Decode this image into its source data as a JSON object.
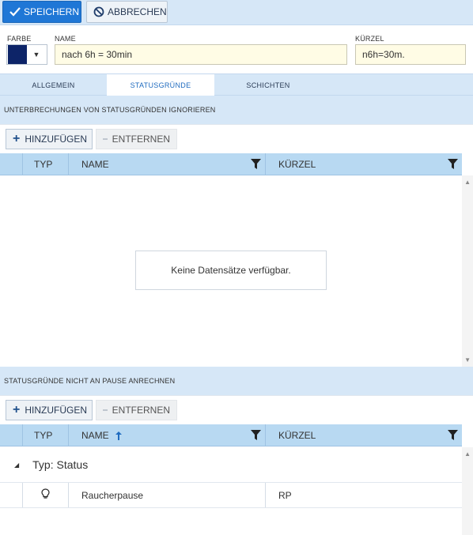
{
  "toolbar": {
    "save_label": "SPEICHERN",
    "cancel_label": "ABBRECHEN"
  },
  "fields": {
    "color_label": "FARBE",
    "color_value": "#0d2468",
    "name_label": "NAME",
    "name_value": "nach 6h = 30min",
    "short_label": "KÜRZEL",
    "short_value": "n6h=30m."
  },
  "tabs": [
    {
      "label": "ALLGEMEIN",
      "active": false
    },
    {
      "label": "STATUSGRÜNDE",
      "active": true
    },
    {
      "label": "SCHICHTEN",
      "active": false
    }
  ],
  "section1": {
    "title": "UNTERBRECHUNGEN VON STATUSGRÜNDEN IGNORIEREN",
    "add_label": "HINZUFÜGEN",
    "remove_label": "ENTFERNEN",
    "columns": {
      "type": "TYP",
      "name": "NAME",
      "short": "KÜRZEL"
    },
    "empty_text": "Keine Datensätze verfügbar."
  },
  "section2": {
    "title": "STATUSGRÜNDE NICHT AN PAUSE ANRECHNEN",
    "add_label": "HINZUFÜGEN",
    "remove_label": "ENTFERNEN",
    "columns": {
      "type": "TYP",
      "name": "NAME",
      "short": "KÜRZEL"
    },
    "sort": {
      "column": "name",
      "direction": "ascending"
    },
    "group_label": "Typ: Status",
    "rows": [
      {
        "icon": "lightbulb-icon",
        "name": "Raucherpause",
        "short": "RP"
      }
    ]
  },
  "colors": {
    "primary": "#1f77d6",
    "header_bg": "#d6e7f7",
    "grid_header_bg": "#b8d9f2",
    "input_bg": "#fffce5"
  }
}
